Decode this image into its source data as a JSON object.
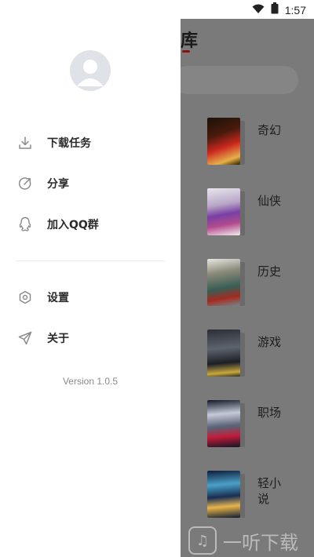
{
  "status_bar": {
    "time": "1:57",
    "icons": [
      "wifi-icon",
      "battery-icon"
    ]
  },
  "background": {
    "title": "库",
    "categories": [
      {
        "label": "奇幻",
        "cover_colors": [
          "#1a1208",
          "#c9261c",
          "#e3b24a"
        ]
      },
      {
        "label": "仙侠",
        "cover_colors": [
          "#e9e6ee",
          "#b24a8b",
          "#7a3fa5"
        ]
      },
      {
        "label": "历史",
        "cover_colors": [
          "#e8e6df",
          "#3a5f55",
          "#a32a20"
        ]
      },
      {
        "label": "游戏",
        "cover_colors": [
          "#2a2e36",
          "#5d646f",
          "#c9a83a"
        ]
      },
      {
        "label": "职场",
        "cover_colors": [
          "#111827",
          "#c6cad8",
          "#c21e3a"
        ]
      },
      {
        "label": "轻小说",
        "cover_colors": [
          "#0c1d3b",
          "#e8b44a",
          "#4aa0c8"
        ]
      }
    ]
  },
  "drawer": {
    "menu": [
      {
        "label": "下载任务",
        "icon": "download-icon"
      },
      {
        "label": "分享",
        "icon": "share-icon"
      },
      {
        "label": "加入QQ群",
        "icon": "qq-icon"
      },
      {
        "label": "设置",
        "icon": "settings-icon"
      },
      {
        "label": "关于",
        "icon": "send-icon"
      }
    ],
    "version": "Version 1.0.5"
  },
  "watermark": {
    "text": "一听下载"
  },
  "colors": {
    "accent": "#7a1818",
    "scrim": "#7a7a7a",
    "icon_gray": "#8c8c8c"
  }
}
